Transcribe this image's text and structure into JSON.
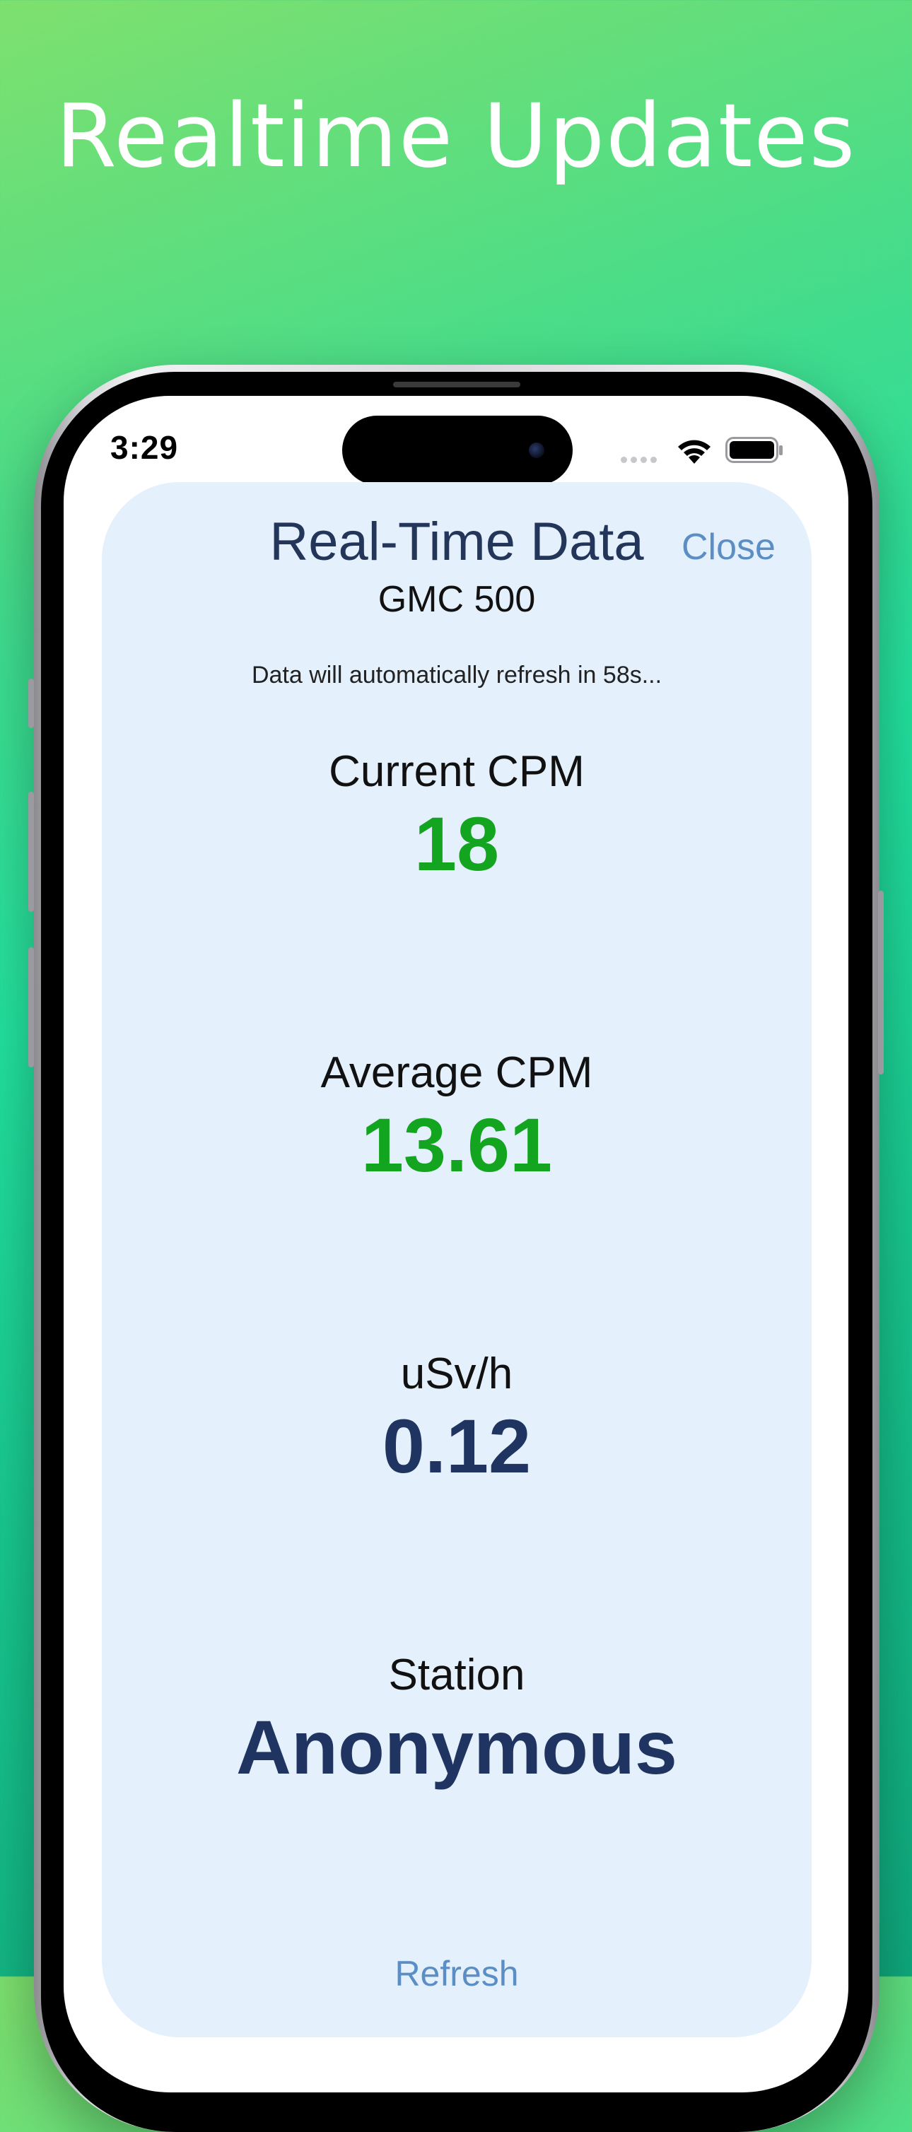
{
  "promo": {
    "headline": "Realtime Updates"
  },
  "status_bar": {
    "time": "3:29"
  },
  "sheet": {
    "title": "Real-Time Data",
    "close_label": "Close",
    "device_name": "GMC 500",
    "refresh_note": "Data will automatically refresh in 58s...",
    "refresh_label": "Refresh"
  },
  "metrics": [
    {
      "label": "Current CPM",
      "value": "18"
    },
    {
      "label": "Average CPM",
      "value": "13.61"
    },
    {
      "label": "uSv/h",
      "value": "0.12"
    },
    {
      "label": "Station",
      "value": "Anonymous"
    }
  ],
  "colors": {
    "value_green": "#13a51f",
    "value_navy": "#1f3460",
    "accent_blue": "#5b8ec4",
    "sheet_background": "#e4f0fc"
  }
}
